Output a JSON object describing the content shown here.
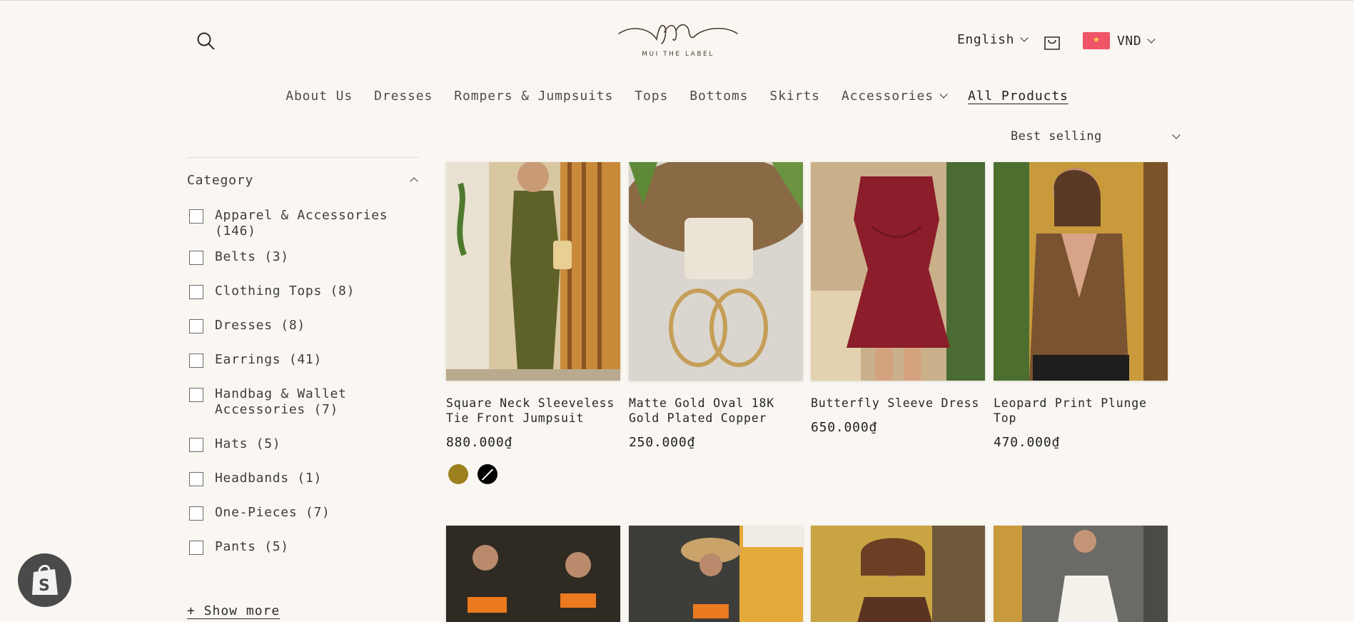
{
  "header": {
    "logo_text": "MUI THE LABEL",
    "language": "English",
    "currency": "VND"
  },
  "nav": [
    "About Us",
    "Dresses",
    "Rompers & Jumpsuits",
    "Tops",
    "Bottoms",
    "Skirts",
    "Accessories",
    "All Products"
  ],
  "sort": {
    "label": "Best selling"
  },
  "sidebar": {
    "heading": "Category",
    "filters": [
      "Apparel & Accessories (146)",
      "Belts (3)",
      "Clothing Tops (8)",
      "Dresses (8)",
      "Earrings (41)",
      "Handbag & Wallet Accessories (7)",
      "Hats (5)",
      "Headbands (1)",
      "One-Pieces (7)",
      "Pants (5)"
    ],
    "show_more": "+ Show more"
  },
  "products": [
    {
      "title": "Square Neck Sleeveless Tie Front Jumpsuit",
      "price": "880.000₫"
    },
    {
      "title": "Matte Gold Oval 18K Gold Plated Copper",
      "price": "250.000₫"
    },
    {
      "title": "Butterfly Sleeve Dress",
      "price": "650.000₫"
    },
    {
      "title": "Leopard Print Plunge Top",
      "price": "470.000₫"
    }
  ],
  "swatch_colors": [
    "#9c801d",
    "#000000"
  ]
}
